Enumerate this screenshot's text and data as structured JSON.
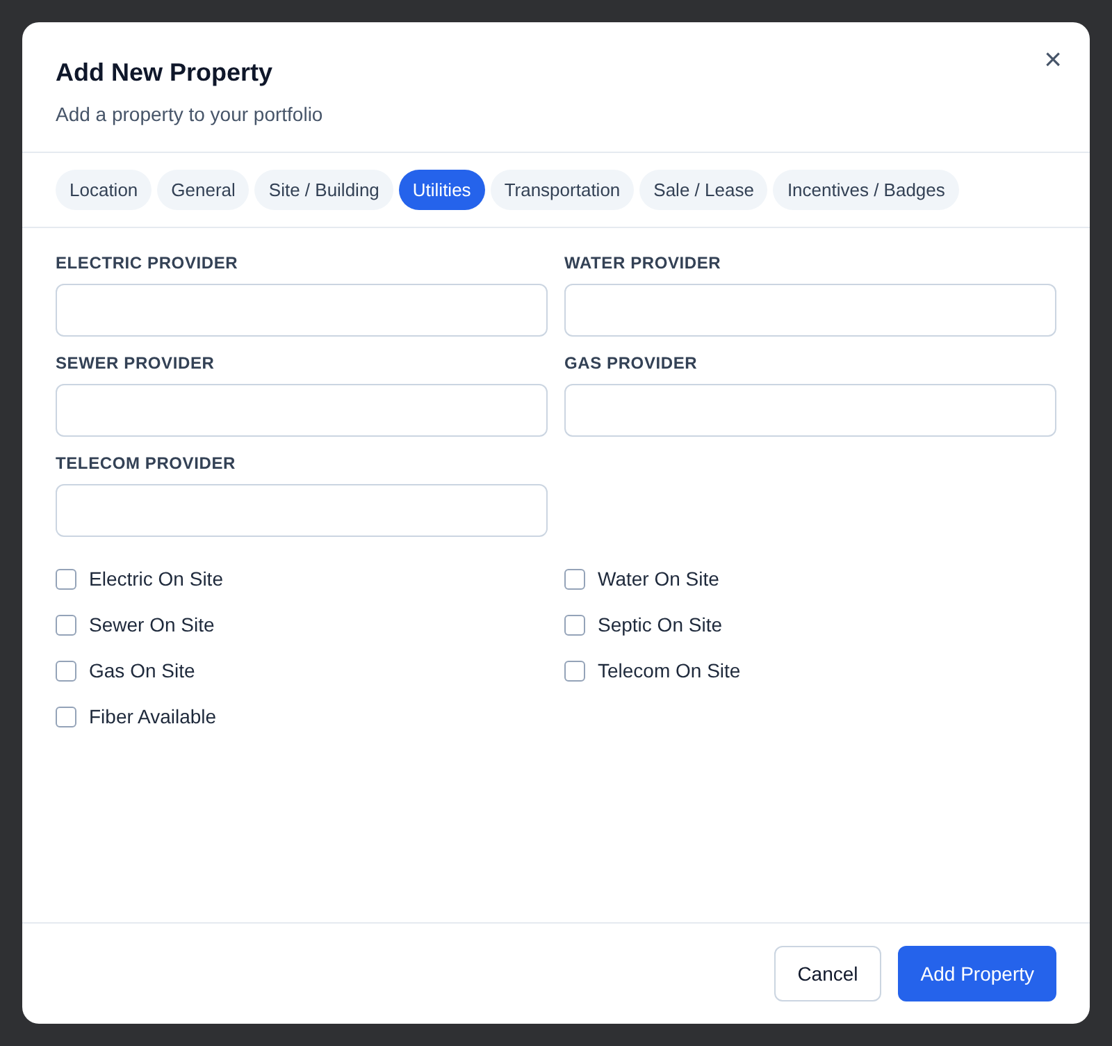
{
  "dialog": {
    "title": "Add New Property",
    "subtitle": "Add a property to your portfolio",
    "close": "×"
  },
  "tabs": [
    {
      "label": "Location",
      "selected": false
    },
    {
      "label": "General",
      "selected": false
    },
    {
      "label": "Site / Building",
      "selected": false
    },
    {
      "label": "Utilities",
      "selected": true
    },
    {
      "label": "Transportation",
      "selected": false
    },
    {
      "label": "Sale / Lease",
      "selected": false
    },
    {
      "label": "Incentives / Badges",
      "selected": false
    }
  ],
  "fields": [
    {
      "label": "ELECTRIC PROVIDER"
    },
    {
      "label": "WATER PROVIDER"
    },
    {
      "label": "SEWER PROVIDER"
    },
    {
      "label": "GAS PROVIDER"
    },
    {
      "label": "TELECOM PROVIDER"
    }
  ],
  "checkboxes": [
    {
      "label": "Electric On Site",
      "checked": false
    },
    {
      "label": "Water On Site",
      "checked": false
    },
    {
      "label": "Sewer On Site",
      "checked": false
    },
    {
      "label": "Septic On Site",
      "checked": false
    },
    {
      "label": "Gas On Site",
      "checked": false
    },
    {
      "label": "Telecom On Site",
      "checked": false
    },
    {
      "label": "Fiber Available",
      "checked": false
    }
  ],
  "buttons": [
    {
      "label": "Cancel",
      "kind": "secondary"
    },
    {
      "label": "Add Property",
      "kind": "primary"
    }
  ]
}
